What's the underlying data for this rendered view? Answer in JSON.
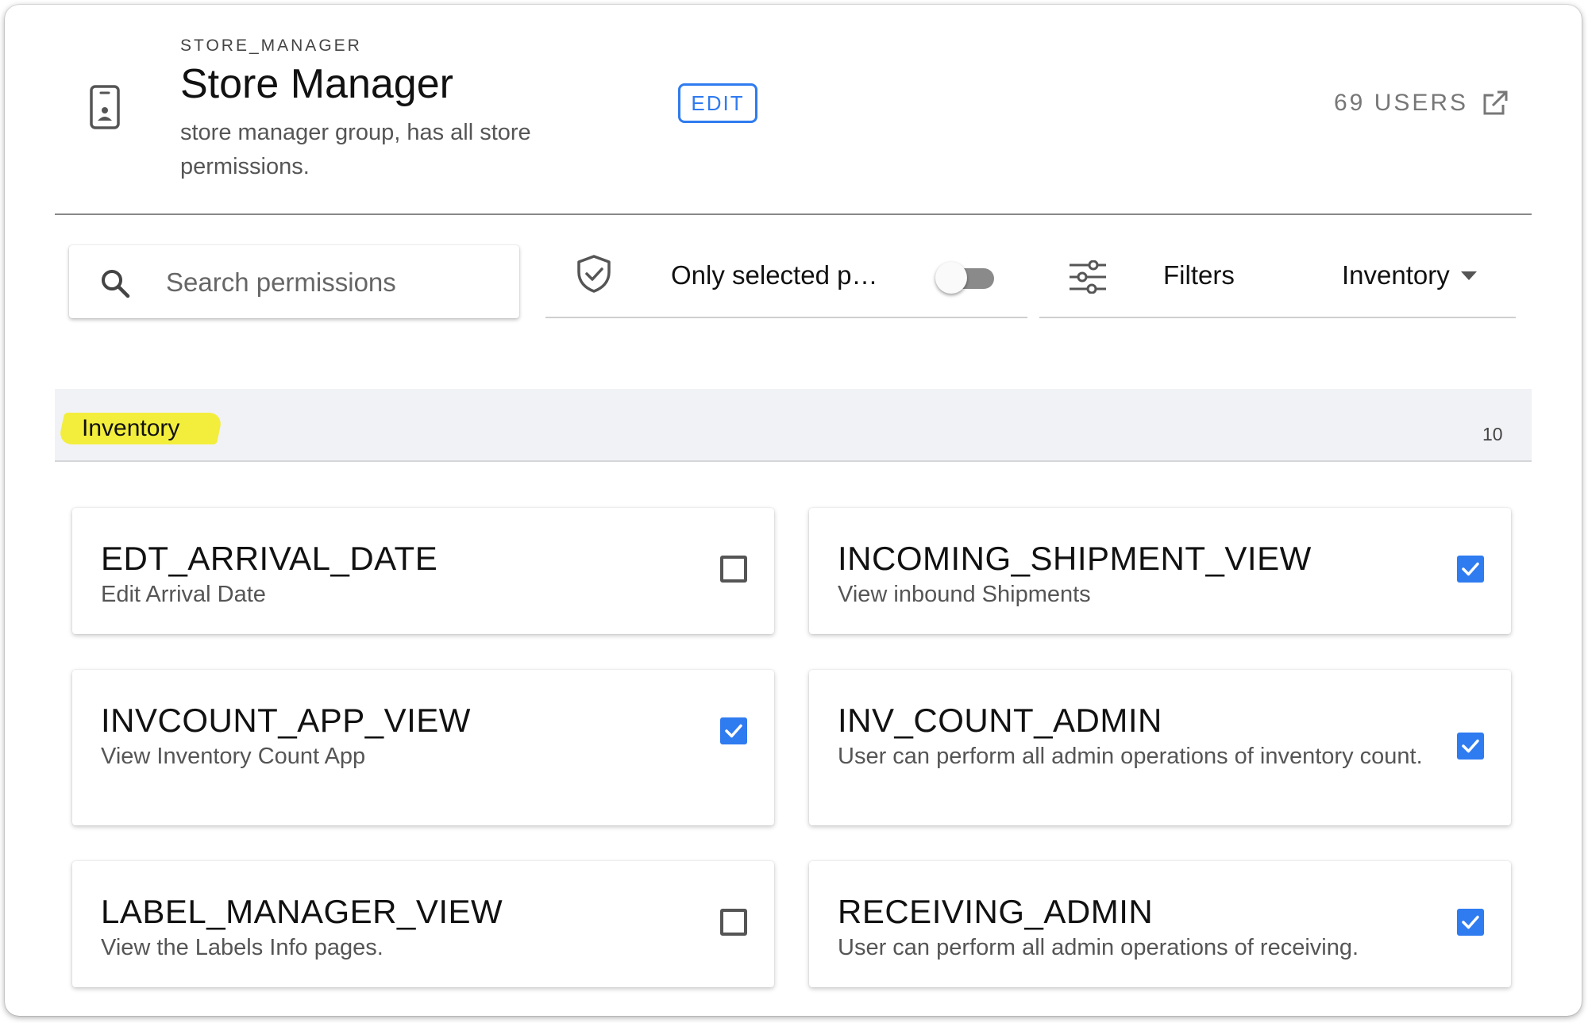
{
  "group": {
    "key": "STORE_MANAGER",
    "title": "Store Manager",
    "description": "store manager group, has all store permissions.",
    "edit_label": "EDIT",
    "users_label": "69 USERS"
  },
  "toolbar": {
    "search_placeholder": "Search permissions",
    "search_value": "",
    "only_selected_label": "Only selected p…",
    "only_selected_on": false,
    "filters_label": "Filters",
    "category_value": "Inventory"
  },
  "section": {
    "title": "Inventory",
    "count": "10"
  },
  "permissions": [
    {
      "name": "EDT_ARRIVAL_DATE",
      "description": "Edit Arrival Date",
      "checked": false
    },
    {
      "name": "INCOMING_SHIPMENT_VIEW",
      "description": "View inbound Shipments",
      "checked": true
    },
    {
      "name": "INVCOUNT_APP_VIEW",
      "description": "View Inventory Count App",
      "checked": true
    },
    {
      "name": "INV_COUNT_ADMIN",
      "description": "User can perform all admin operations of inventory count.",
      "checked": true
    },
    {
      "name": "LABEL_MANAGER_VIEW",
      "description": "View the Labels Info pages.",
      "checked": false
    },
    {
      "name": "RECEIVING_ADMIN",
      "description": "User can perform all admin operations of receiving.",
      "checked": true
    }
  ],
  "colors": {
    "accent": "#2f7bf0",
    "highlight": "#f3ee3c",
    "section_bg": "#f1f2f5"
  },
  "icons": {
    "header": "id-badge-icon",
    "users_link": "external-link-icon",
    "search": "search-icon",
    "only_selected": "shield-check-icon",
    "filters": "sliders-icon",
    "category": "caret-down-icon",
    "checkbox_checked": "check-icon"
  }
}
